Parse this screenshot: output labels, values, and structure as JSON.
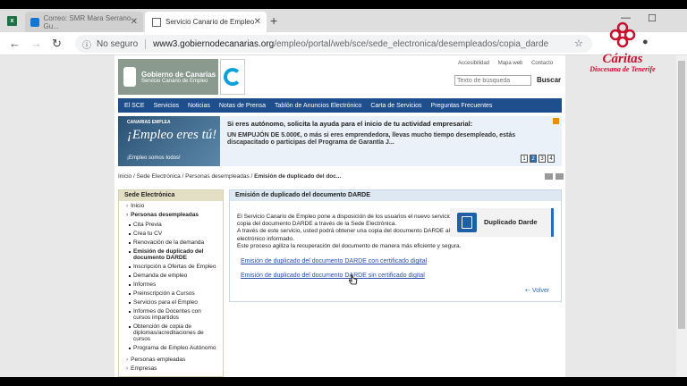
{
  "browser": {
    "tabs": [
      {
        "label": "Correo: SMR Mara Serrano Gu..."
      },
      {
        "label": "Servicio Canario de Empleo"
      }
    ],
    "insecure_label": "No seguro",
    "url_host": "www3.gobiernodecanarias.org",
    "url_path": "/empleo/portal/web/sce/sede_electronica/desempleados/copia_darde"
  },
  "watermark": {
    "name": "Cáritas",
    "sub": "Diocesana de Tenerife"
  },
  "header": {
    "gob_line1": "Gobierno de Canarias",
    "gob_line2": "Servicio Canario de Empleo",
    "top_links": [
      "Accesibilidad",
      "Mapa web",
      "Contacto"
    ],
    "search_placeholder": "Texto de búsqueda",
    "search_button": "Buscar"
  },
  "menu": [
    "El SCE",
    "Servicios",
    "Noticias",
    "Notas de Prensa",
    "Tablón de Anuncios Electrónico",
    "Carta de Servicios",
    "Preguntas Frecuentes"
  ],
  "banner": {
    "img_top": "CANARIAS EMPLEA",
    "img_big": "¡Empleo eres tú!",
    "img_sub": "¡Empleo somos todos!",
    "title": "Si eres autónomo, solicita la ayuda para el inicio de tu actividad empresarial:",
    "desc": "UN EMPUJÓN DE 5.000€, o más si eres emprendedora, llevas mucho tiempo desempleado, estás discapacitado o participas del Programa de Garantía J...",
    "pages": [
      "1",
      "2",
      "3",
      "4"
    ],
    "active_page": "2"
  },
  "breadcrumb": {
    "items": [
      "Inicio",
      "Sede Electrónica",
      "Personas desempleadas"
    ],
    "current": "Emisión de duplicado del doc..."
  },
  "sidebar": {
    "title": "Sede Electrónica",
    "inicio": "Inicio",
    "section": "Personas desempleadas",
    "subitems": [
      "Cita Previa",
      "Crea tu CV",
      "Renovación de la demanda",
      "Emisión de duplicado del documento DARDE",
      "Inscripción a Ofertas de Empleo",
      "Demanda de empleo",
      "Informes",
      "Preinscripción a Cursos",
      "Servicios para el Empleo",
      "Informes de Docentes con cursos impartidos",
      "Obtención de copia de diplomas/acreditaciones de cursos",
      "Programa de Empleo Autónomo"
    ],
    "after": [
      "Personas empleadas",
      "Empresas"
    ]
  },
  "panel": {
    "title": "Emisión de duplicado del documento DARDE",
    "para1": "El Servicio Canario de Empleo pone a disposición de los usuarios el nuevo servicio de copia del documento DARDE a través de la Sede Electrónica.",
    "para2": "A través de este servicio, usted podrá obtener una copia del documento DARDE al correo electrónico informado.",
    "para3": "Este proceso agiliza la recuperación del documento de manera más eficiente y segura.",
    "card_label": "Duplicado Darde",
    "link_with_cert": "Emisión de duplicado del documento DARDE con certificado digital",
    "link_without_cert": "Emisión de duplicado del documento DARDE sin certificado digital",
    "back": "Volver"
  }
}
